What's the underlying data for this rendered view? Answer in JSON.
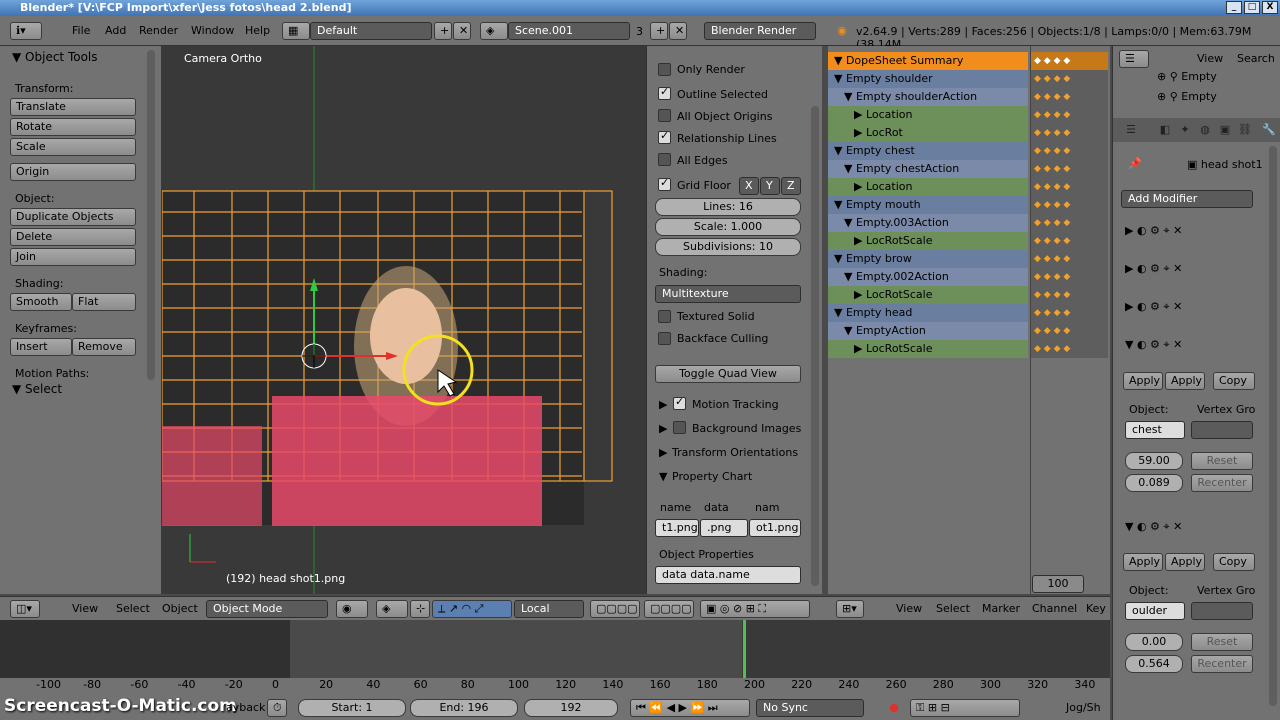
{
  "titlebar": {
    "title": "Blender* [V:\\FCP Import\\xfer\\Jess fotos\\head 2.blend]",
    "min": "_",
    "max": "□",
    "close": "X"
  },
  "topbar": {
    "menus": [
      "File",
      "Add",
      "Render",
      "Window",
      "Help"
    ],
    "screen": "Default",
    "scene": "Scene.001",
    "scene_users": "3",
    "engine": "Blender Render",
    "stats": "v2.64.9 | Verts:289 | Faces:256 | Objects:1/8 | Lamps:0/0 | Mem:63.79M (38.14M"
  },
  "tools": {
    "header": "Object Tools",
    "transform_label": "Transform:",
    "translate": "Translate",
    "rotate": "Rotate",
    "scale": "Scale",
    "origin": "Origin",
    "object_label": "Object:",
    "duplicate": "Duplicate Objects",
    "delete": "Delete",
    "join": "Join",
    "shading_label": "Shading:",
    "smooth": "Smooth",
    "flat": "Flat",
    "keyframes_label": "Keyframes:",
    "insert": "Insert",
    "remove": "Remove",
    "motion_paths": "Motion Paths:",
    "select": "Select"
  },
  "viewport": {
    "label": "Camera Ortho",
    "footer": "(192) head shot1.png"
  },
  "props": {
    "only_render": "Only Render",
    "outline_selected": "Outline Selected",
    "all_object_origins": "All Object Origins",
    "relationship_lines": "Relationship Lines",
    "all_edges": "All Edges",
    "grid_floor": "Grid Floor",
    "x": "X",
    "y": "Y",
    "z": "Z",
    "lines": "Lines: 16",
    "scale": "Scale: 1.000",
    "subdivisions": "Subdivisions: 10",
    "shading_label": "Shading:",
    "shading_value": "Multitexture",
    "textured_solid": "Textured Solid",
    "backface_culling": "Backface Culling",
    "toggle_quad": "Toggle Quad View",
    "motion_tracking": "Motion Tracking",
    "background_images": "Background Images",
    "transform_orientations": "Transform Orientations",
    "property_chart": "Property Chart",
    "col_name": "name",
    "col_data": "data",
    "col_nam": "nam",
    "cell1": "t1.png",
    "cell2": ".png",
    "cell3": "ot1.png",
    "object_properties": "Object Properties",
    "data_name": "data data.name"
  },
  "dopesheet": {
    "rows": [
      {
        "label": "DopeSheet Summary",
        "indent": 0,
        "kind": "summary"
      },
      {
        "label": "Empty shoulder",
        "indent": 0,
        "kind": "object"
      },
      {
        "label": "Empty shoulderAction",
        "indent": 1,
        "kind": "action"
      },
      {
        "label": "Location",
        "indent": 2,
        "kind": "group"
      },
      {
        "label": "LocRot",
        "indent": 2,
        "kind": "group"
      },
      {
        "label": "Empty chest",
        "indent": 0,
        "kind": "object"
      },
      {
        "label": "Empty chestAction",
        "indent": 1,
        "kind": "action"
      },
      {
        "label": "Location",
        "indent": 2,
        "kind": "group"
      },
      {
        "label": "Empty mouth",
        "indent": 0,
        "kind": "object"
      },
      {
        "label": "Empty.003Action",
        "indent": 1,
        "kind": "action"
      },
      {
        "label": "LocRotScale",
        "indent": 2,
        "kind": "group"
      },
      {
        "label": "Empty brow",
        "indent": 0,
        "kind": "object"
      },
      {
        "label": "Empty.002Action",
        "indent": 1,
        "kind": "action"
      },
      {
        "label": "LocRotScale",
        "indent": 2,
        "kind": "group"
      },
      {
        "label": "Empty head",
        "indent": 0,
        "kind": "object"
      },
      {
        "label": "EmptyAction",
        "indent": 1,
        "kind": "action"
      },
      {
        "label": "LocRotScale",
        "indent": 2,
        "kind": "group"
      }
    ],
    "zoom": "100"
  },
  "rightpanel": {
    "view": "View",
    "search": "Search",
    "outliner_item": "Empty",
    "object_name": "head shot1",
    "add_modifier": "Add Modifier",
    "apply1": "Apply",
    "apply2": "Apply",
    "copy": "Copy",
    "object_label": "Object:",
    "vertex_group": "Vertex Gro",
    "obj1": "chest",
    "val1": "59.00",
    "val1b": "0.089",
    "reset": "Reset",
    "recenter": "Recenter",
    "obj2": "oulder",
    "val2": "0.00",
    "val2b": "0.564"
  },
  "bottombar": {
    "view": "View",
    "select": "Select",
    "object": "Object",
    "mode": "Object Mode",
    "pivot": "Local",
    "ds_view": "View",
    "ds_select": "Select",
    "marker": "Marker",
    "channel": "Channel",
    "key": "Key"
  },
  "timeline": {
    "ticks": [
      "-100",
      "-80",
      "-60",
      "-40",
      "-20",
      "0",
      "20",
      "40",
      "60",
      "80",
      "100",
      "120",
      "140",
      "160",
      "180",
      "200",
      "220",
      "240",
      "260",
      "280",
      "300",
      "320",
      "340"
    ],
    "start": "Start: 1",
    "end": "End: 196",
    "frame": "192",
    "sync": "No Sync",
    "playback": "ayback",
    "watermark": "Screencast-O-Matic.com",
    "jog": "Jog/Sh"
  },
  "colors": {
    "accent": "#f08d1c",
    "selected": "#f5a623",
    "grid": "#f0a030",
    "jacket": "#e84a6a"
  }
}
